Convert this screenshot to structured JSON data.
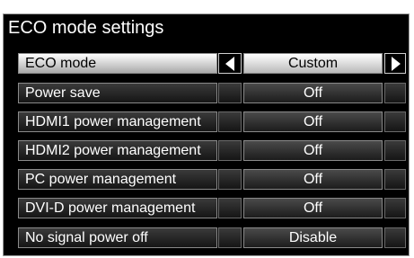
{
  "panel": {
    "title": "ECO mode settings"
  },
  "rows": [
    {
      "label": "ECO mode",
      "value": "Custom"
    },
    {
      "label": "Power save",
      "value": "Off"
    },
    {
      "label": "HDMI1 power management",
      "value": "Off"
    },
    {
      "label": "HDMI2 power management",
      "value": "Off"
    },
    {
      "label": "PC power management",
      "value": "Off"
    },
    {
      "label": "DVI-D power management",
      "value": "Off"
    },
    {
      "label": "No signal power off",
      "value": "Disable"
    }
  ],
  "icons": {
    "prev": "arrow-left-icon",
    "next": "arrow-right-icon"
  }
}
